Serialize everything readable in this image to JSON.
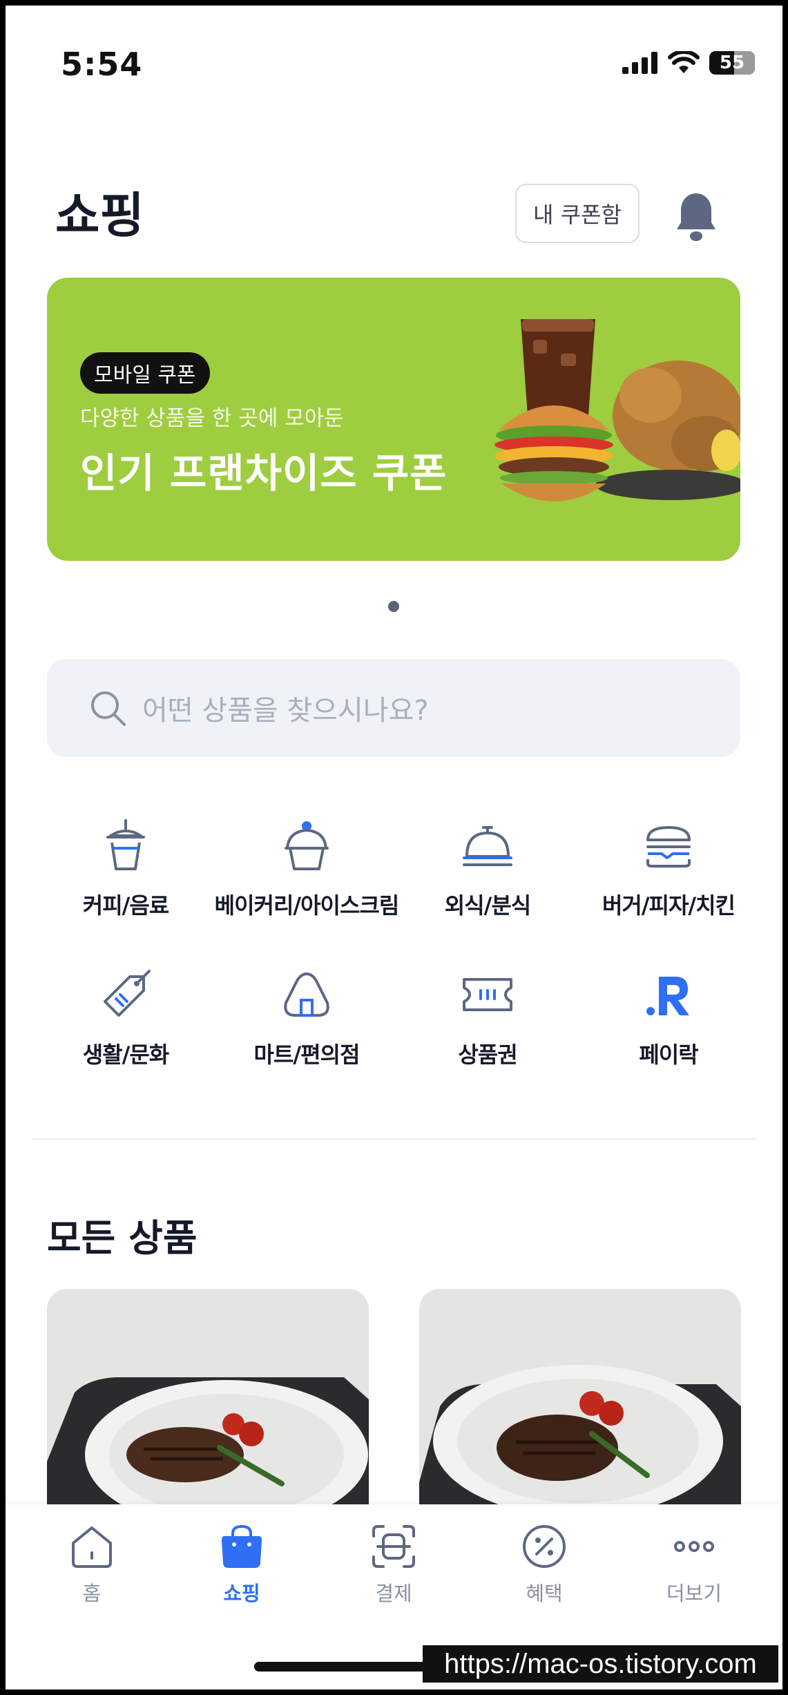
{
  "status_bar": {
    "time": "5:54",
    "battery": "55"
  },
  "header": {
    "title": "쇼핑",
    "coupon_button": "내 쿠폰함"
  },
  "banner": {
    "tag": "모바일 쿠폰",
    "subtitle": "다양한 상품을 한 곳에 모아둔",
    "title": "인기 프랜차이즈 쿠폰",
    "background": "#9ecd40"
  },
  "search": {
    "placeholder": "어떤 상품을 찾으시나요?"
  },
  "categories": [
    {
      "label": "커피/음료",
      "icon": "cup-icon"
    },
    {
      "label": "베이커리/아이스크림",
      "icon": "ice-cream-icon"
    },
    {
      "label": "외식/분식",
      "icon": "cloche-icon"
    },
    {
      "label": "버거/피자/치킨",
      "icon": "burger-icon"
    },
    {
      "label": "생활/문화",
      "icon": "tag-icon"
    },
    {
      "label": "마트/편의점",
      "icon": "onigiri-icon"
    },
    {
      "label": "상품권",
      "icon": "ticket-icon"
    },
    {
      "label": "페이락",
      "icon": "pay-r-icon"
    }
  ],
  "section": {
    "title": "모든 상품"
  },
  "nav": [
    {
      "label": "홈",
      "icon": "home-icon",
      "active": false
    },
    {
      "label": "쇼핑",
      "icon": "shopping-bag-icon",
      "active": true
    },
    {
      "label": "결제",
      "icon": "scan-pay-icon",
      "active": false
    },
    {
      "label": "혜택",
      "icon": "percent-icon",
      "active": false
    },
    {
      "label": "더보기",
      "icon": "more-icon",
      "active": false
    }
  ],
  "colors": {
    "accent": "#2f6ff5",
    "icon_gray": "#5d6781",
    "text_dark": "#15192a"
  },
  "watermark": "https://mac-os.tistory.com"
}
